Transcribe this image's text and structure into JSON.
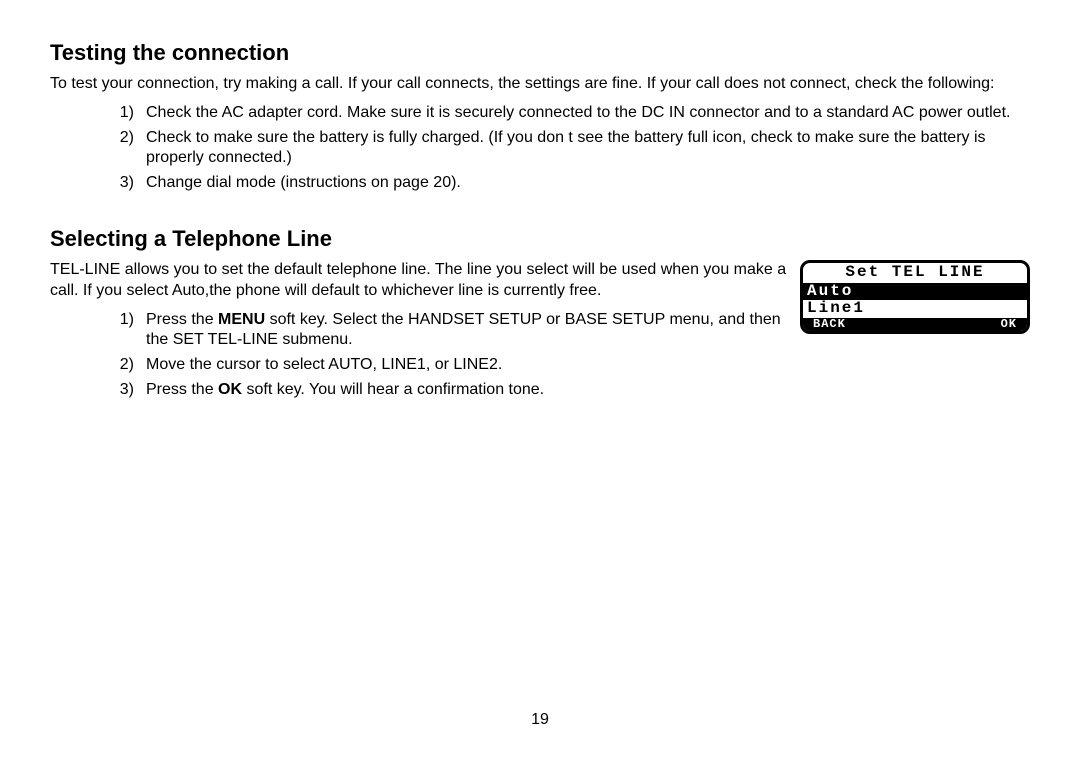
{
  "section1": {
    "heading": "Testing the connection",
    "intro": "To test your connection, try making a call. If your call connects, the settings are fine. If your call does not connect, check the following:",
    "items": [
      {
        "num": "1)",
        "text": "Check the AC adapter cord. Make sure it is securely connected to the DC IN connector and to a standard AC power outlet."
      },
      {
        "num": "2)",
        "text": "Check to make sure the battery is fully charged. (If you don t see the  battery full  icon, check to make sure the battery is properly connected.)"
      },
      {
        "num": "3)",
        "text": "Change dial mode (instructions on page 20)."
      }
    ]
  },
  "section2": {
    "heading": "Selecting a Telephone Line",
    "intro": "TEL-LINE allows you to set the default telephone line. The line you select will be used when you make a call. If you select Auto,the phone will default to whichever line is currently free.",
    "items": [
      {
        "num": "1)",
        "pre": "Press the ",
        "bold": "MENU",
        "post": " soft key. Select the HANDSET SETUP or BASE SETUP menu, and then the SET TEL-LINE submenu."
      },
      {
        "num": "2)",
        "pre": "Move the cursor to select AUTO, LINE1, or LINE2.",
        "bold": "",
        "post": ""
      },
      {
        "num": "3)",
        "pre": "Press the ",
        "bold": "OK",
        "post": " soft key. You will hear a confirmation tone."
      }
    ]
  },
  "lcd": {
    "title": "Set TEL LINE",
    "selected": "Auto",
    "option": "Line1",
    "softkey_left": "BACK",
    "softkey_right": "OK"
  },
  "page_number": "19"
}
